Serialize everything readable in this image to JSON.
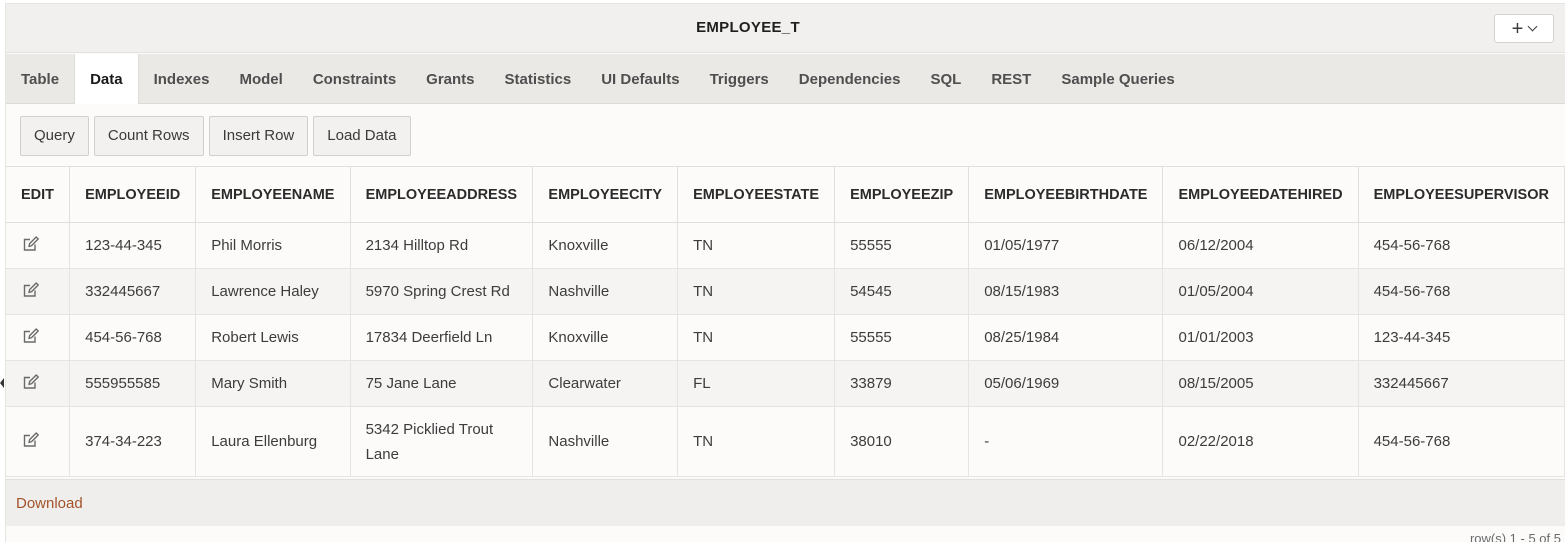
{
  "window": {
    "title": "EMPLOYEE_T",
    "add_menu_icon": "plus-icon",
    "add_menu_chevron": "chevron-down-icon"
  },
  "tabs": [
    {
      "label": "Table"
    },
    {
      "label": "Data",
      "active": true
    },
    {
      "label": "Indexes"
    },
    {
      "label": "Model"
    },
    {
      "label": "Constraints"
    },
    {
      "label": "Grants"
    },
    {
      "label": "Statistics"
    },
    {
      "label": "UI Defaults"
    },
    {
      "label": "Triggers"
    },
    {
      "label": "Dependencies"
    },
    {
      "label": "SQL"
    },
    {
      "label": "REST"
    },
    {
      "label": "Sample Queries"
    }
  ],
  "toolbar": {
    "query": "Query",
    "count_rows": "Count Rows",
    "insert_row": "Insert Row",
    "load_data": "Load Data"
  },
  "table": {
    "columns": [
      "EDIT",
      "EMPLOYEEID",
      "EMPLOYEENAME",
      "EMPLOYEEADDRESS",
      "EMPLOYEECITY",
      "EMPLOYEESTATE",
      "EMPLOYEEZIP",
      "EMPLOYEEBIRTHDATE",
      "EMPLOYEEDATEHIRED",
      "EMPLOYEESUPERVISOR"
    ],
    "edit_icon": "edit-icon",
    "rows": [
      {
        "id": "123-44-345",
        "name": "Phil Morris",
        "address": "2134 Hilltop Rd",
        "city": "Knoxville",
        "state": "TN",
        "zip": "55555",
        "birthdate": "01/05/1977",
        "datehired": "06/12/2004",
        "supervisor": "454-56-768"
      },
      {
        "id": "332445667",
        "name": "Lawrence Haley",
        "address": "5970 Spring Crest Rd",
        "city": "Nashville",
        "state": "TN",
        "zip": "54545",
        "birthdate": "08/15/1983",
        "datehired": "01/05/2004",
        "supervisor": "454-56-768"
      },
      {
        "id": "454-56-768",
        "name": "Robert Lewis",
        "address": "17834 Deerfield Ln",
        "city": "Knoxville",
        "state": "TN",
        "zip": "55555",
        "birthdate": "08/25/1984",
        "datehired": "01/01/2003",
        "supervisor": "123-44-345"
      },
      {
        "id": "555955585",
        "name": "Mary Smith",
        "address": "75 Jane Lane",
        "city": "Clearwater",
        "state": "FL",
        "zip": "33879",
        "birthdate": "05/06/1969",
        "datehired": "08/15/2005",
        "supervisor": "332445667"
      },
      {
        "id": "374-34-223",
        "name": "Laura Ellenburg",
        "address": "5342 Picklied Trout Lane",
        "address_line1": "5342 Picklied Trout",
        "address_line2": "Lane",
        "city": "Nashville",
        "state": "TN",
        "zip": "38010",
        "birthdate": "-",
        "datehired": "02/22/2018",
        "supervisor": "454-56-768"
      }
    ]
  },
  "footer": {
    "download": "Download",
    "row_info": "row(s) 1 - 5 of 5"
  },
  "colors": {
    "link": "#a3532b",
    "header_bg": "#f1f0ee",
    "tab_bar_bg": "#ebe9e6"
  }
}
